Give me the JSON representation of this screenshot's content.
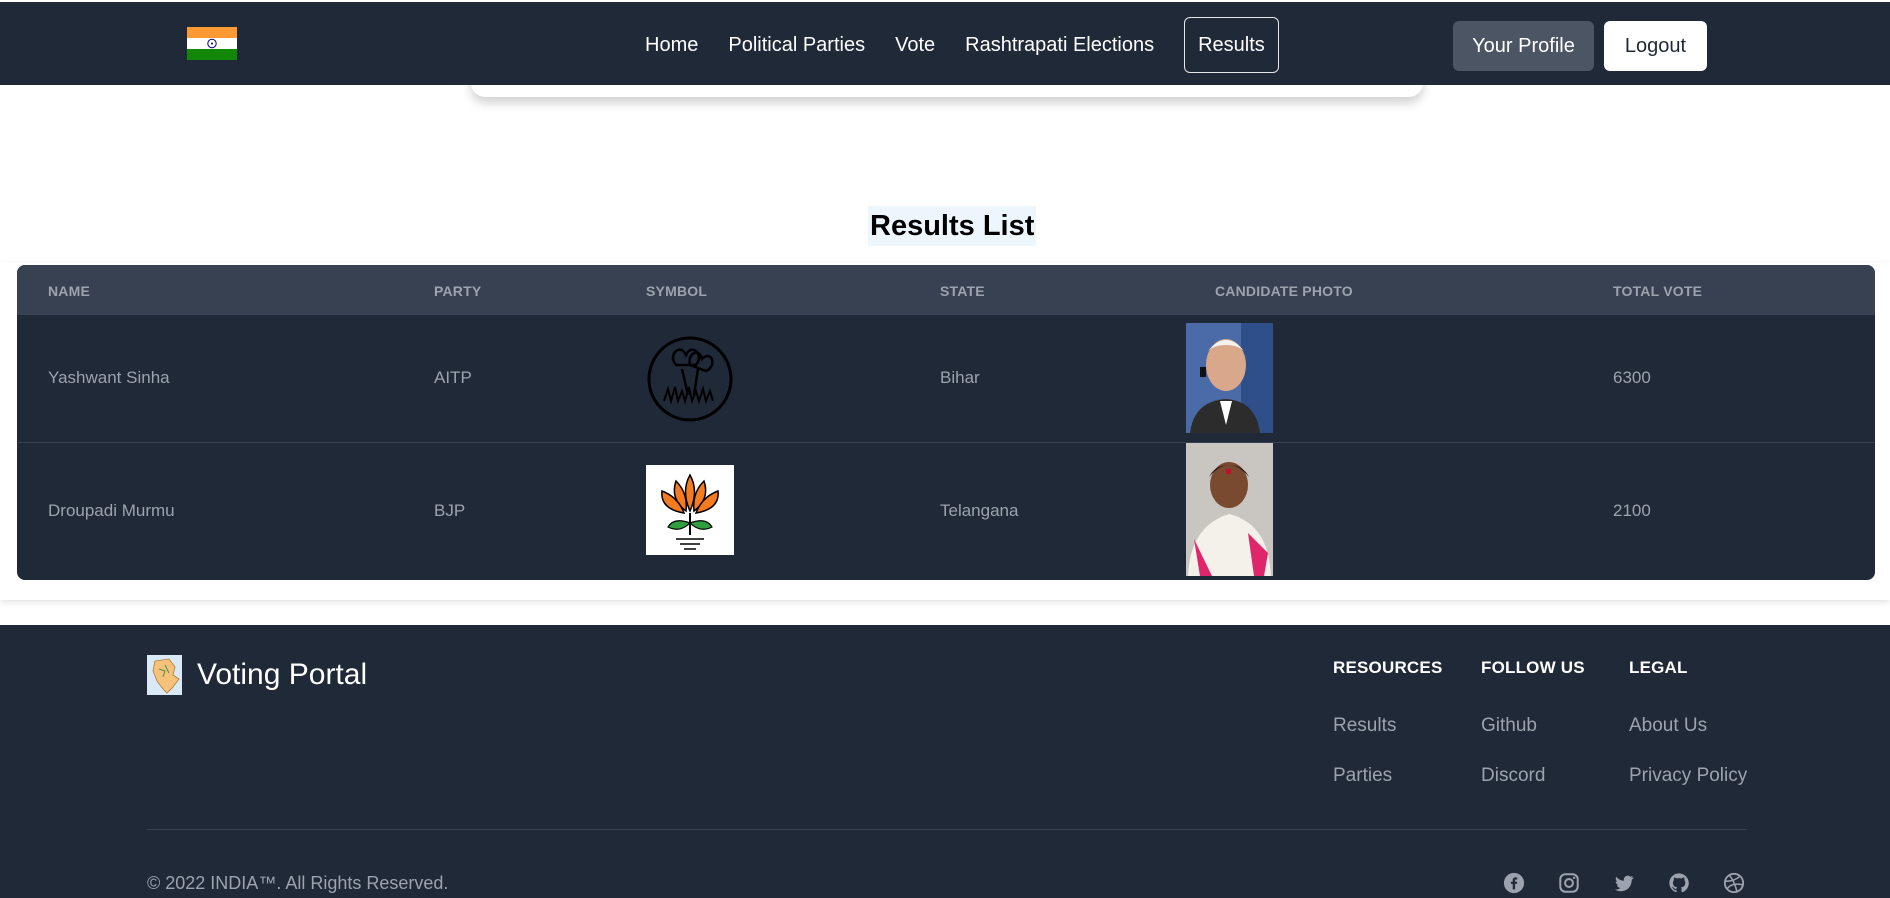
{
  "nav": {
    "links": [
      "Home",
      "Political Parties",
      "Vote",
      "Rashtrapati Elections",
      "Results"
    ],
    "active": "Results",
    "profile_label": "Your Profile",
    "logout_label": "Logout"
  },
  "results": {
    "title": "Results List",
    "columns": [
      "Name",
      "Party",
      "Symbol",
      "State",
      "Candidate Photo",
      "Total Vote"
    ],
    "rows": [
      {
        "name": "Yashwant Sinha",
        "party": "AITP",
        "symbol": "twin-flowers-grass-symbol",
        "state": "Bihar",
        "photo": "candidate-photo-yashwant-sinha",
        "total_vote": "6300"
      },
      {
        "name": "Droupadi Murmu",
        "party": "BJP",
        "symbol": "lotus-symbol",
        "state": "Telangana",
        "photo": "candidate-photo-droupadi-murmu",
        "total_vote": "2100"
      }
    ]
  },
  "footer": {
    "brand": "Voting Portal",
    "columns": [
      {
        "title": "RESOURCES",
        "links": [
          "Results",
          "Parties"
        ]
      },
      {
        "title": "FOLLOW US",
        "links": [
          "Github",
          "Discord"
        ]
      },
      {
        "title": "LEGAL",
        "links": [
          "About Us",
          "Privacy Policy"
        ]
      }
    ],
    "copyright": "© 2022 INDIA™. All Rights Reserved.",
    "social_icons": [
      "facebook-icon",
      "instagram-icon",
      "twitter-icon",
      "github-icon",
      "dribbble-icon"
    ]
  },
  "colors": {
    "navbar_bg": "#1f2937",
    "table_header_bg": "#374151",
    "muted_text": "#9ca3af",
    "saffron": "#ff9933",
    "india_green": "#138808",
    "title_highlight": "#eef6fd"
  }
}
